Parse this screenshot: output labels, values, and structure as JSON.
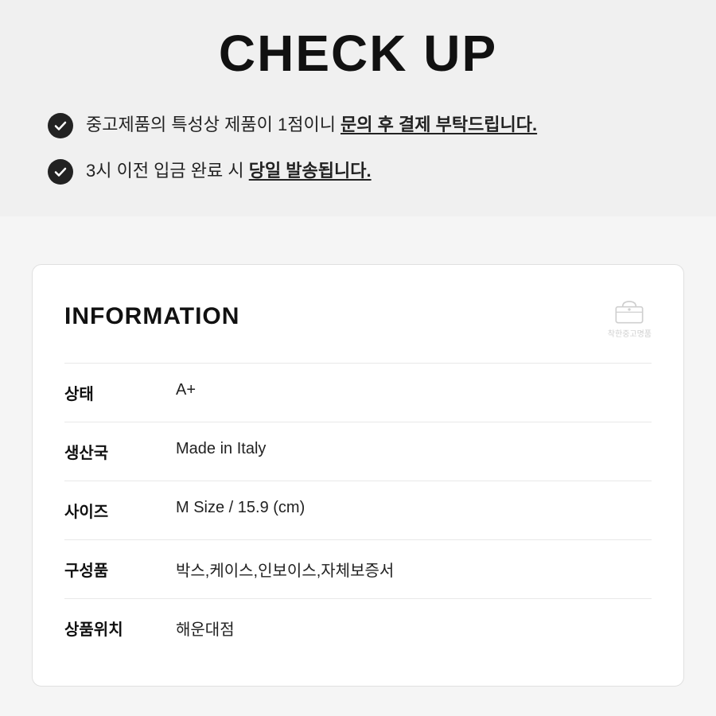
{
  "header": {
    "title": "CHECK UP",
    "backgroundColor": "#f0f0f0"
  },
  "checkItems": [
    {
      "id": 1,
      "text_before": "중고제품의 특성상 제품이 1점이니 ",
      "text_highlight": "문의 후 결제 부탁드립니다.",
      "text_after": ""
    },
    {
      "id": 2,
      "text_before": "3시 이전 입금 완료 시 ",
      "text_highlight": "당일 발송됩니다.",
      "text_after": ""
    }
  ],
  "infoSection": {
    "title": "INFORMATION",
    "brandLogoAlt": "착한중고명품",
    "brandSubtext": "착한중고명품",
    "rows": [
      {
        "label": "상태",
        "value": "A+"
      },
      {
        "label": "생산국",
        "value": "Made in Italy"
      },
      {
        "label": "사이즈",
        "value": "M Size / 15.9 (cm)"
      },
      {
        "label": "구성품",
        "value": "박스,케이스,인보이스,자체보증서"
      },
      {
        "label": "상품위치",
        "value": "해운대점"
      }
    ]
  }
}
